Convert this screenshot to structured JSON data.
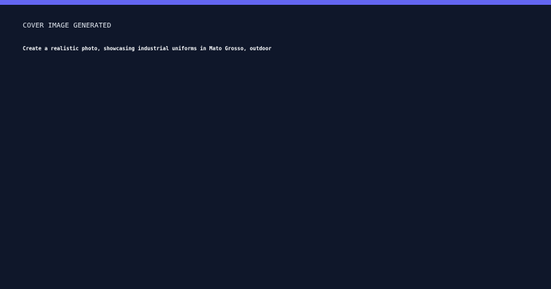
{
  "colors": {
    "background": "#0f172a",
    "accent": "#6366f1",
    "title_text": "#e2e8f0",
    "body_text": "#f8fafc"
  },
  "status": {
    "title": "COVER IMAGE GENERATED"
  },
  "prompt": {
    "text": "Create a realistic photo, showcasing industrial uniforms in Mato Grosso, outdoor"
  }
}
